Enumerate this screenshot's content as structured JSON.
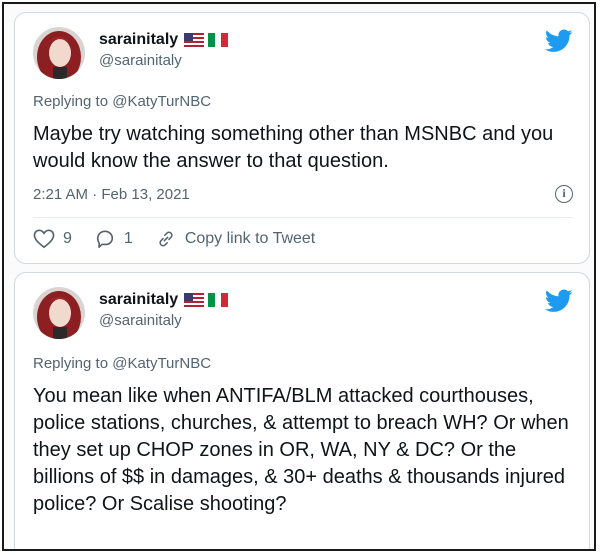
{
  "tweets": [
    {
      "display_name": "sarainitaly",
      "handle": "@sarainitaly",
      "flags": [
        "us-flag-icon",
        "italy-flag-icon"
      ],
      "replying_to": "Replying to @KatyTurNBC",
      "text": "Maybe try watching something other than MSNBC and you would know the answer to that question.",
      "timestamp": "2:21 AM · Feb 13, 2021",
      "likes": "9",
      "replies": "1",
      "copy_link_label": "Copy link to Tweet"
    },
    {
      "display_name": "sarainitaly",
      "handle": "@sarainitaly",
      "flags": [
        "us-flag-icon",
        "italy-flag-icon"
      ],
      "replying_to": "Replying to @KatyTurNBC",
      "text": "You mean like when ANTIFA/BLM attacked courthouses, police stations, churches, & attempt to breach WH? Or when they set up CHOP zones in OR, WA, NY & DC? Or the billions of $$ in damages, & 30+ deaths & thousands injured police? Or Scalise shooting?"
    }
  ],
  "colors": {
    "twitter_blue": "#1d9bf0",
    "secondary_text": "#536471",
    "primary_text": "#0f1419"
  }
}
